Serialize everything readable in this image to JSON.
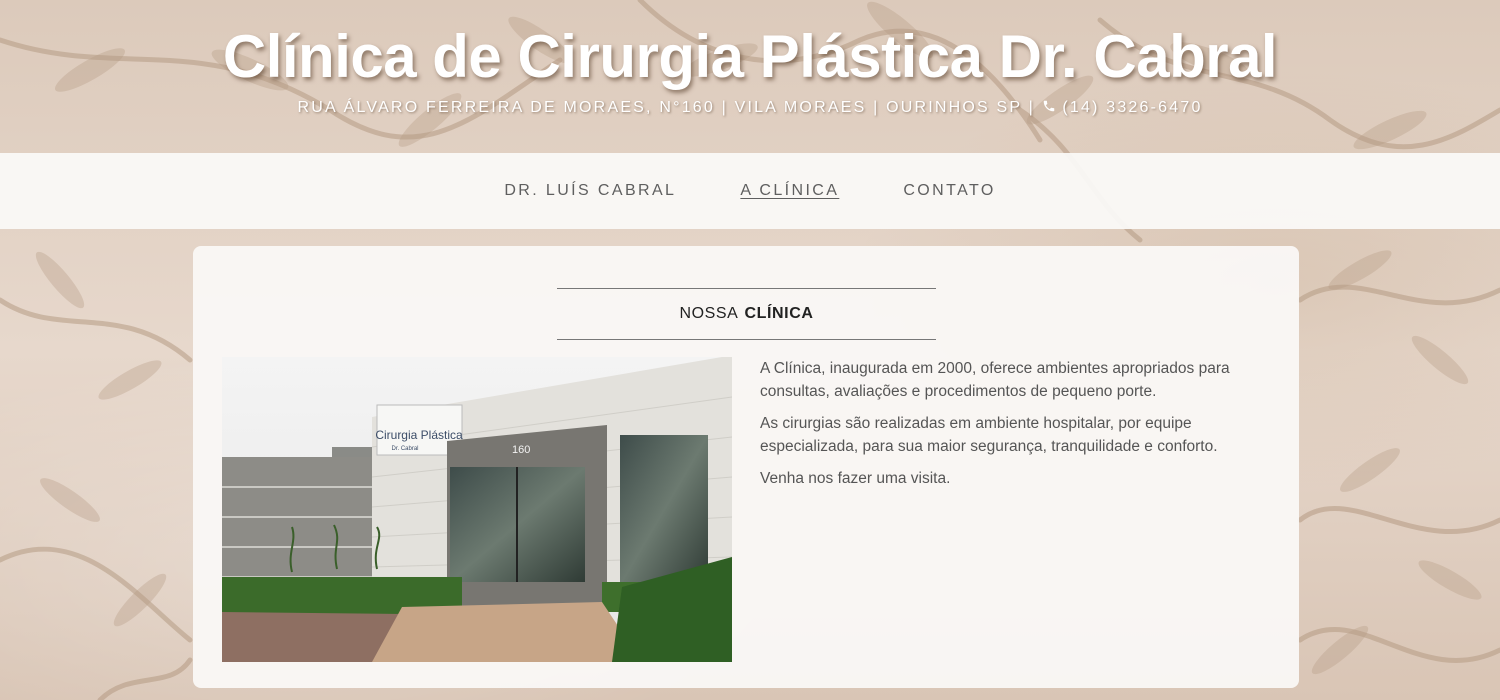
{
  "header": {
    "title": "Clínica de Cirurgia Plástica Dr. Cabral",
    "address": "RUA ÁLVARO FERREIRA DE MORAES, N°160 | VILA MORAES | OURINHOS SP | ",
    "phone": "(14) 3326-6470",
    "phone_icon": "phone-icon"
  },
  "nav": {
    "items": [
      {
        "label": "DR. LUÍS CABRAL",
        "active": false
      },
      {
        "label": "A CLÍNICA",
        "active": true
      },
      {
        "label": "CONTATO",
        "active": false
      }
    ]
  },
  "main": {
    "section_title_prefix": "NOSSA",
    "section_title_bold": "CLÍNICA",
    "photo": {
      "sign_line1": "Cirurgia Plástica",
      "sign_line2": "Dr. Cabral",
      "building_number": "160"
    },
    "paragraphs": [
      "A Clínica, inaugurada em 2000, oferece ambientes apropriados para consultas, avaliações e procedimentos de pequeno porte.",
      "As cirurgias são realizadas em ambiente hospitalar, por equipe especializada, para sua maior segurança, tranquilidade e conforto.",
      "Venha nos fazer uma visita."
    ]
  },
  "colors": {
    "background": "#e2d2c5",
    "nav_bg": "#faf9f7",
    "nav_text": "#5f5f5f",
    "body_text": "#555555"
  }
}
